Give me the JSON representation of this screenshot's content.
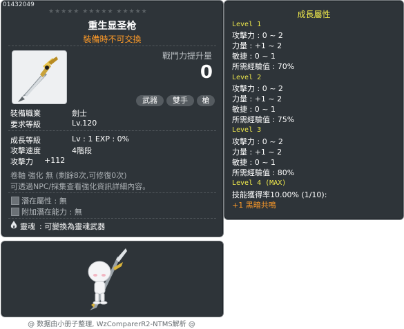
{
  "tooltip": {
    "item_id": "01432049",
    "stars": "★★★★★ ★★★★★ ★★★★★",
    "name": "重生显圣枪",
    "trade": "裝備時不可交換",
    "power_label": "戰鬥力提升量",
    "power_value": "0",
    "tags": [
      "武器",
      "雙手",
      "槍"
    ],
    "rows1": [
      {
        "label": "裝備職業",
        "value": "劍士"
      },
      {
        "label": "要求等級",
        "value": "Lv.120"
      }
    ],
    "rows2": [
      {
        "label": "成長等級",
        "value": "Lv : 1   EXP : 0%"
      },
      {
        "label": "攻擊速度",
        "value": "4階段"
      },
      {
        "label": "攻擊力",
        "value": "+112"
      }
    ],
    "scroll_info": "卷軸 強化 無 (剩餘8次,可修復0次)",
    "npc_info": "可透過NPC/採集查看強化資訊詳細內容。",
    "potential": "潛在屬性 : 無",
    "add_potential": "附加潛在能力 : 無",
    "soul_label": "靈魂",
    "soul_value": ": 可變換為靈魂武器"
  },
  "growth": {
    "title": "成長屬性",
    "levels": [
      {
        "level": "Level 1",
        "stats": [
          "攻擊力 : 0 ~ 2",
          "力量 : +1 ~ 2",
          "敏捷 : 0 ~ 1",
          "所需經驗值 : 70%"
        ]
      },
      {
        "level": "Level 2",
        "stats": [
          "攻擊力 : 0 ~ 2",
          "力量 : +1 ~ 2",
          "敏捷 : 0 ~ 1",
          "所需經驗值 : 75%"
        ]
      },
      {
        "level": "Level 3",
        "stats": [
          "攻擊力 : 0 ~ 2",
          "力量 : +1 ~ 2",
          "敏捷 : 0 ~ 1",
          "所需經驗值 : 80%"
        ]
      }
    ],
    "max_level": "Level 4 (MAX)",
    "skill_rate": "技能獲得率10.00% (1/10):",
    "skill_name": "+1 黑暗共鳴"
  },
  "footer": "@ 数据由小册子整理, WzComparerR2-NTMS解析 @",
  "colors": {
    "panel_bg": "#2e3439",
    "accent_orange": "#ff9b28",
    "level_yellow": "#f0ea4c"
  }
}
